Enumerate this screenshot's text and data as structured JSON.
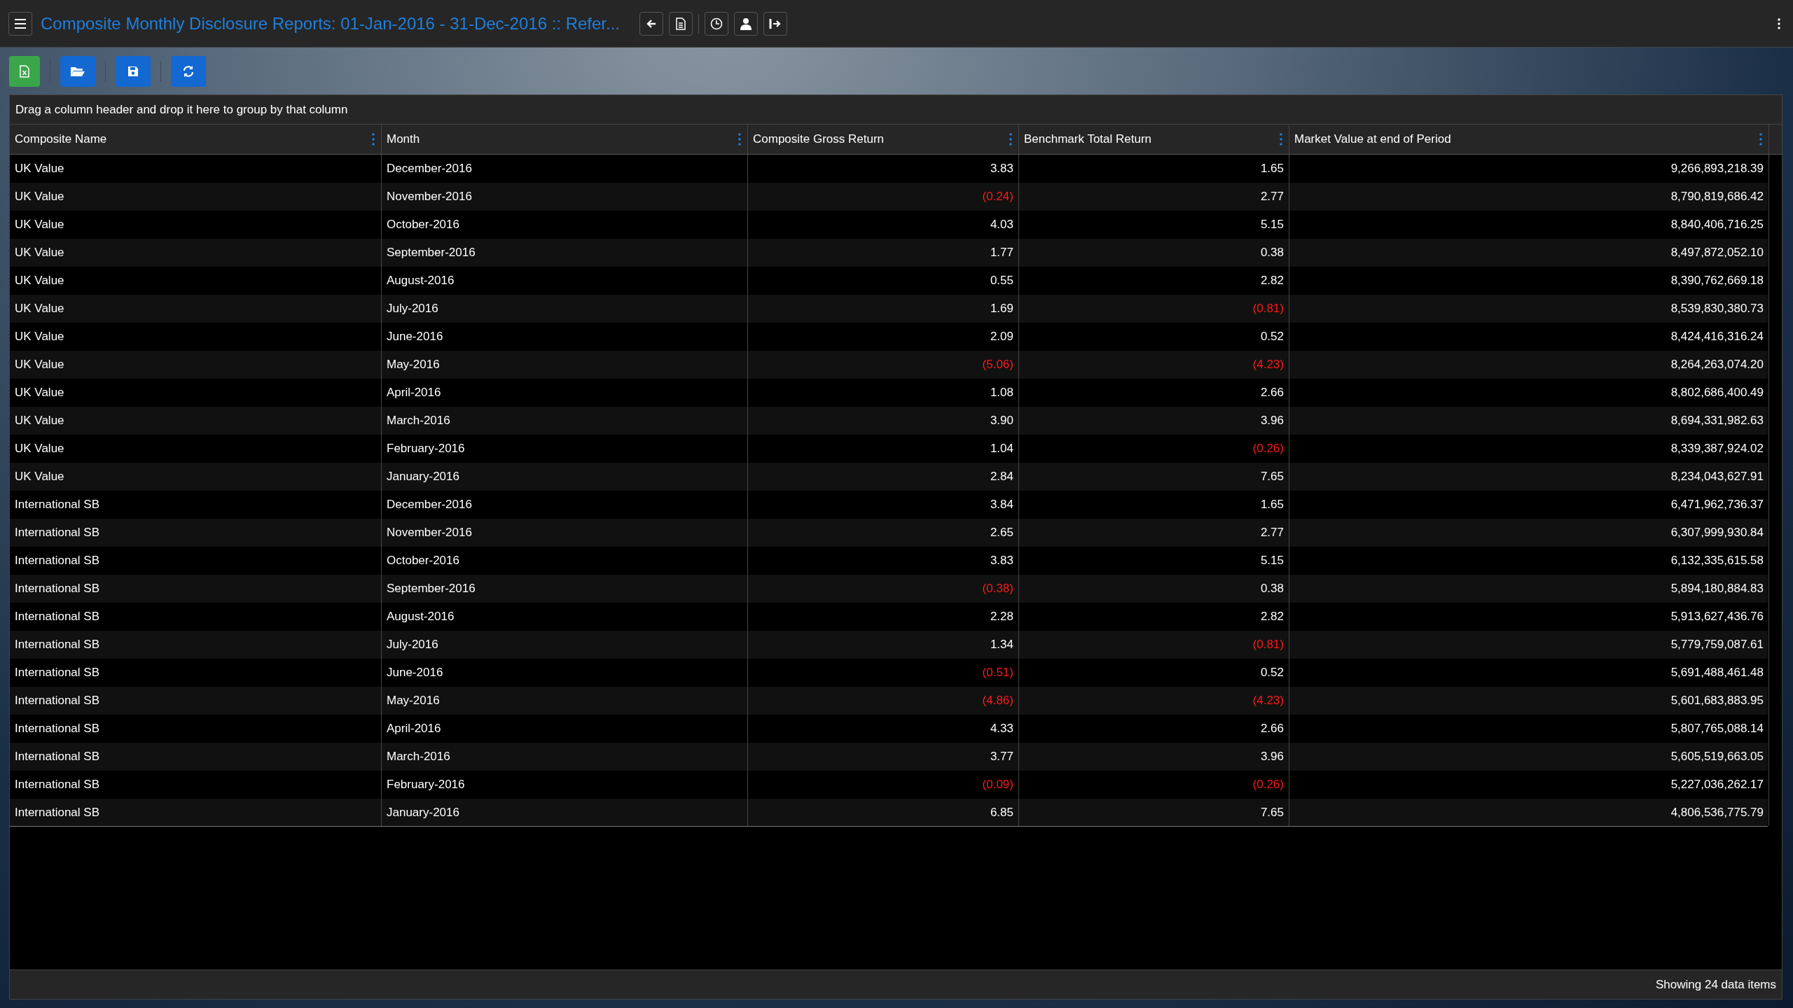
{
  "title": "Composite Monthly Disclosure Reports: 01-Jan-2016 - 31-Dec-2016 :: Refer...",
  "group_panel": "Drag a column header and drop it here to group by that column",
  "columns": [
    "Composite Name",
    "Month",
    "Composite Gross Return",
    "Benchmark Total Return",
    "Market Value at end of Period"
  ],
  "rows": [
    {
      "composite": "UK Value",
      "month": "December-2016",
      "gross": {
        "text": "3.83",
        "negative": false
      },
      "benchmark": {
        "text": "1.65",
        "negative": false
      },
      "market_value": "9,266,893,218.39"
    },
    {
      "composite": "UK Value",
      "month": "November-2016",
      "gross": {
        "text": "(0.24)",
        "negative": true
      },
      "benchmark": {
        "text": "2.77",
        "negative": false
      },
      "market_value": "8,790,819,686.42"
    },
    {
      "composite": "UK Value",
      "month": "October-2016",
      "gross": {
        "text": "4.03",
        "negative": false
      },
      "benchmark": {
        "text": "5.15",
        "negative": false
      },
      "market_value": "8,840,406,716.25"
    },
    {
      "composite": "UK Value",
      "month": "September-2016",
      "gross": {
        "text": "1.77",
        "negative": false
      },
      "benchmark": {
        "text": "0.38",
        "negative": false
      },
      "market_value": "8,497,872,052.10"
    },
    {
      "composite": "UK Value",
      "month": "August-2016",
      "gross": {
        "text": "0.55",
        "negative": false
      },
      "benchmark": {
        "text": "2.82",
        "negative": false
      },
      "market_value": "8,390,762,669.18"
    },
    {
      "composite": "UK Value",
      "month": "July-2016",
      "gross": {
        "text": "1.69",
        "negative": false
      },
      "benchmark": {
        "text": "(0.81)",
        "negative": true
      },
      "market_value": "8,539,830,380.73"
    },
    {
      "composite": "UK Value",
      "month": "June-2016",
      "gross": {
        "text": "2.09",
        "negative": false
      },
      "benchmark": {
        "text": "0.52",
        "negative": false
      },
      "market_value": "8,424,416,316.24"
    },
    {
      "composite": "UK Value",
      "month": "May-2016",
      "gross": {
        "text": "(5.06)",
        "negative": true
      },
      "benchmark": {
        "text": "(4.23)",
        "negative": true
      },
      "market_value": "8,264,263,074.20"
    },
    {
      "composite": "UK Value",
      "month": "April-2016",
      "gross": {
        "text": "1.08",
        "negative": false
      },
      "benchmark": {
        "text": "2.66",
        "negative": false
      },
      "market_value": "8,802,686,400.49"
    },
    {
      "composite": "UK Value",
      "month": "March-2016",
      "gross": {
        "text": "3.90",
        "negative": false
      },
      "benchmark": {
        "text": "3.96",
        "negative": false
      },
      "market_value": "8,694,331,982.63"
    },
    {
      "composite": "UK Value",
      "month": "February-2016",
      "gross": {
        "text": "1.04",
        "negative": false
      },
      "benchmark": {
        "text": "(0.26)",
        "negative": true
      },
      "market_value": "8,339,387,924.02"
    },
    {
      "composite": "UK Value",
      "month": "January-2016",
      "gross": {
        "text": "2.84",
        "negative": false
      },
      "benchmark": {
        "text": "7.65",
        "negative": false
      },
      "market_value": "8,234,043,627.91"
    },
    {
      "composite": "International SB",
      "month": "December-2016",
      "gross": {
        "text": "3.84",
        "negative": false
      },
      "benchmark": {
        "text": "1.65",
        "negative": false
      },
      "market_value": "6,471,962,736.37"
    },
    {
      "composite": "International SB",
      "month": "November-2016",
      "gross": {
        "text": "2.65",
        "negative": false
      },
      "benchmark": {
        "text": "2.77",
        "negative": false
      },
      "market_value": "6,307,999,930.84"
    },
    {
      "composite": "International SB",
      "month": "October-2016",
      "gross": {
        "text": "3.83",
        "negative": false
      },
      "benchmark": {
        "text": "5.15",
        "negative": false
      },
      "market_value": "6,132,335,615.58"
    },
    {
      "composite": "International SB",
      "month": "September-2016",
      "gross": {
        "text": "(0.38)",
        "negative": true
      },
      "benchmark": {
        "text": "0.38",
        "negative": false
      },
      "market_value": "5,894,180,884.83"
    },
    {
      "composite": "International SB",
      "month": "August-2016",
      "gross": {
        "text": "2.28",
        "negative": false
      },
      "benchmark": {
        "text": "2.82",
        "negative": false
      },
      "market_value": "5,913,627,436.76"
    },
    {
      "composite": "International SB",
      "month": "July-2016",
      "gross": {
        "text": "1.34",
        "negative": false
      },
      "benchmark": {
        "text": "(0.81)",
        "negative": true
      },
      "market_value": "5,779,759,087.61"
    },
    {
      "composite": "International SB",
      "month": "June-2016",
      "gross": {
        "text": "(0.51)",
        "negative": true
      },
      "benchmark": {
        "text": "0.52",
        "negative": false
      },
      "market_value": "5,691,488,461.48"
    },
    {
      "composite": "International SB",
      "month": "May-2016",
      "gross": {
        "text": "(4.86)",
        "negative": true
      },
      "benchmark": {
        "text": "(4.23)",
        "negative": true
      },
      "market_value": "5,601,683,883.95"
    },
    {
      "composite": "International SB",
      "month": "April-2016",
      "gross": {
        "text": "4.33",
        "negative": false
      },
      "benchmark": {
        "text": "2.66",
        "negative": false
      },
      "market_value": "5,807,765,088.14"
    },
    {
      "composite": "International SB",
      "month": "March-2016",
      "gross": {
        "text": "3.77",
        "negative": false
      },
      "benchmark": {
        "text": "3.96",
        "negative": false
      },
      "market_value": "5,605,519,663.05"
    },
    {
      "composite": "International SB",
      "month": "February-2016",
      "gross": {
        "text": "(0.09)",
        "negative": true
      },
      "benchmark": {
        "text": "(0.26)",
        "negative": true
      },
      "market_value": "5,227,036,262.17"
    },
    {
      "composite": "International SB",
      "month": "January-2016",
      "gross": {
        "text": "6.85",
        "negative": false
      },
      "benchmark": {
        "text": "7.65",
        "negative": false
      },
      "market_value": "4,806,536,775.79"
    }
  ],
  "footer": "Showing 24 data items"
}
